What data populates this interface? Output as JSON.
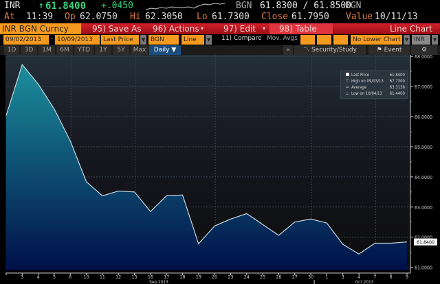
{
  "quote": {
    "ticker": "INR",
    "direction_icon": "up-arrow",
    "last": "61.8400",
    "change": "+.0450",
    "source1": "BGN",
    "bid_ask": "61.8300 / 61.8500",
    "source2": "BGN",
    "at_label": "At",
    "at_value": "11:39",
    "open_label": "Op",
    "open_value": "62.0750",
    "high_label": "Hi",
    "high_value": "62.3050",
    "low_label": "Lo",
    "low_value": "61.7300",
    "close_label": "Close",
    "close_value": "61.7950",
    "value_label": "Value",
    "value_date": "10/11/13"
  },
  "toolbar": {
    "security": "INR BGN Curncy",
    "save_as": "95) Save As",
    "actions": "96) Actions",
    "edit": "97) Edit",
    "table": "98) Table",
    "chart_type": "Line Chart"
  },
  "settings": {
    "start_date": "09/02/2013",
    "dash": "-",
    "end_date": "10/09/2013",
    "field": "Last Price",
    "source": "BGN",
    "style": "Line",
    "compare": "11) Compare",
    "mov_avgs": "Mov. Avgs",
    "lower_chart": "No Lower Chart",
    "currency": "INR"
  },
  "periods": {
    "tabs": [
      "1D",
      "3D",
      "1M",
      "6M",
      "YTD",
      "1Y",
      "5Y",
      "Max"
    ],
    "frequency": "Daily ▼",
    "collapse": "«",
    "security_study": "Security/Study",
    "event": "Event",
    "settings_icon": "gear-icon"
  },
  "colors": {
    "fill_top": "#1c8f9c",
    "fill_bottom": "#001048",
    "line": "#c8d8e0",
    "accent": "#f49a1e",
    "toolbar": "#c41a22"
  },
  "chart_data": {
    "type": "area",
    "x": [
      "Sep 2",
      "Sep 3",
      "Sep 4",
      "Sep 5",
      "Sep 6",
      "Sep 10",
      "Sep 11",
      "Sep 12",
      "Sep 13",
      "Sep 16",
      "Sep 17",
      "Sep 18",
      "Sep 19",
      "Sep 20",
      "Sep 23",
      "Sep 24",
      "Sep 25",
      "Sep 26",
      "Sep 27",
      "Sep 30",
      "Oct 1",
      "Oct 3",
      "Oct 4",
      "Oct 7",
      "Oct 8",
      "Oct 9"
    ],
    "tick_labels": [
      "",
      "3",
      "4",
      "5",
      "6",
      "10",
      "11",
      "12",
      "13",
      "16",
      "17",
      "18",
      "19",
      "20",
      "23",
      "24",
      "25",
      "26",
      "27",
      "30",
      "1",
      "3",
      "4",
      "7",
      "8",
      "9"
    ],
    "month_labels": [
      "Sep 2013",
      "Oct 2013"
    ],
    "series": [
      {
        "name": "Last Price",
        "values": [
          66.04,
          67.73,
          67.08,
          66.25,
          65.19,
          63.84,
          63.37,
          63.53,
          63.5,
          62.85,
          63.37,
          63.4,
          61.78,
          62.37,
          62.6,
          62.78,
          62.42,
          62.06,
          62.5,
          62.6,
          62.47,
          61.76,
          61.44,
          61.8,
          61.8,
          61.84
        ]
      }
    ],
    "ylim": [
      60.9,
      68.05
    ],
    "yticks": [
      "61.0000",
      "62.0000",
      "63.0000",
      "64.0000",
      "65.0000",
      "66.0000",
      "67.0000",
      "68.0000"
    ],
    "last_value_label": "61.8400",
    "grid": true,
    "legend_position": "top-right",
    "legend": [
      {
        "label": "Last Price",
        "value": "61.8400"
      },
      {
        "label": "High on 09/03/13",
        "value": "67.7300"
      },
      {
        "label": "Average",
        "value": "63.3138"
      },
      {
        "label": "Low on 10/04/13",
        "value": "61.4400"
      }
    ]
  }
}
